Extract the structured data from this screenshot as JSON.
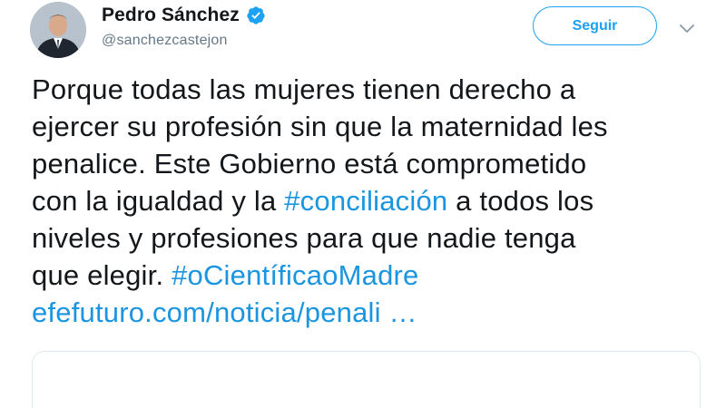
{
  "user": {
    "display_name": "Pedro Sánchez",
    "handle": "@sanchezcastejon",
    "verified": true
  },
  "actions": {
    "follow_label": "Seguir"
  },
  "tweet": {
    "line1": "Porque todas las mujeres tienen derecho a",
    "line2": "ejercer su profesión sin que la maternidad les",
    "line3": "penalice. Este Gobierno está comprometido",
    "line4_before": "con la igualdad y la ",
    "line4_hashtag": "#conciliación",
    "line4_after": " a todos los",
    "line5": "niveles y profesiones para que nadie tenga",
    "line6_before": "que elegir. ",
    "line6_hashtag": "#oCientíficaoMadre",
    "link": "efefuturo.com/noticia/penali …"
  },
  "colors": {
    "accent": "#1da1f2",
    "link": "#1b95e0",
    "text": "#14171a",
    "secondary": "#657786",
    "border": "#e1e8ed"
  },
  "icons": {
    "verified": "verified-badge-icon",
    "menu": "chevron-down-icon"
  }
}
